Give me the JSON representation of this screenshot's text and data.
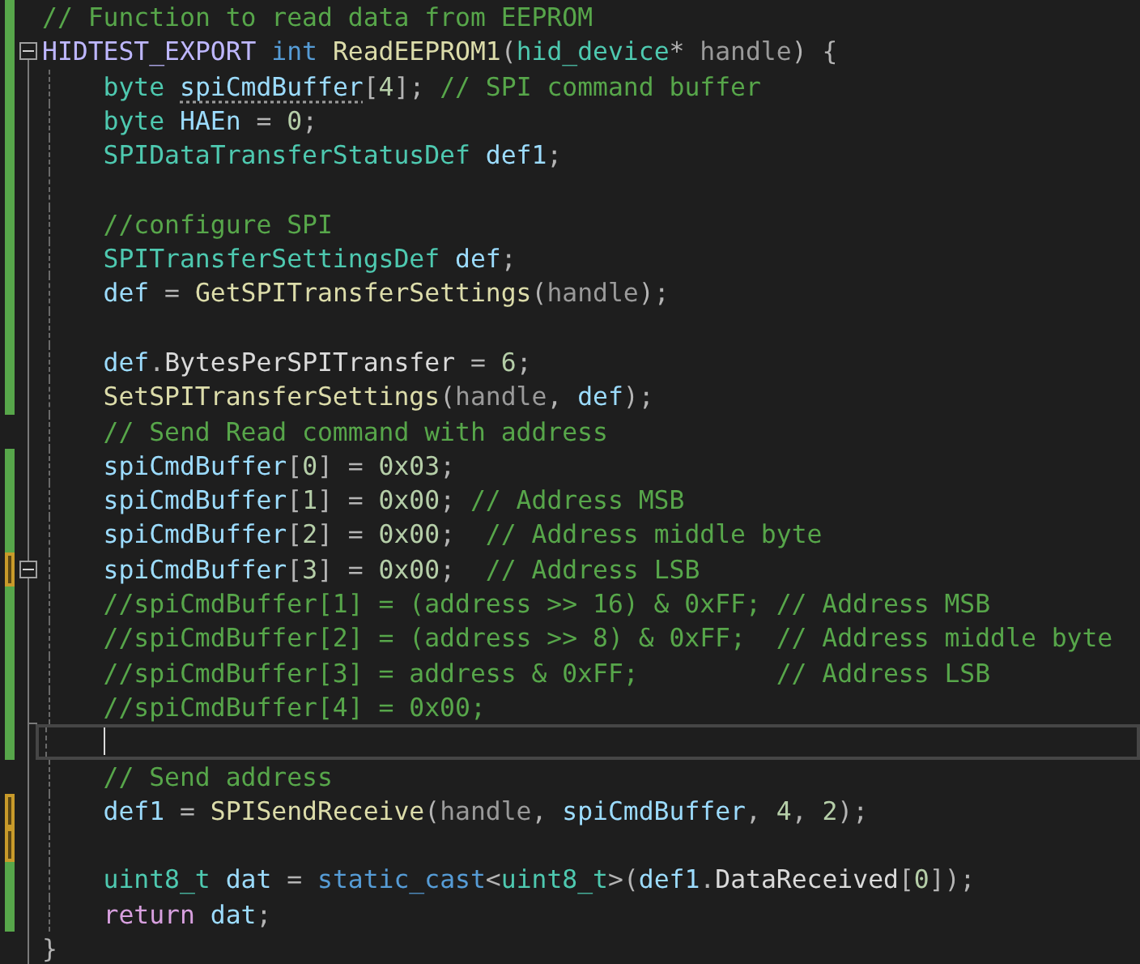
{
  "editor": {
    "lines": [
      {
        "modified": true,
        "saved": true,
        "in_fold": false,
        "collapsible": false,
        "fold_end": false,
        "guide": false,
        "tokens": [
          {
            "kind": "comment",
            "text": "// Function to read data from EEPROM"
          }
        ]
      },
      {
        "modified": true,
        "saved": true,
        "in_fold": true,
        "collapsible": true,
        "fold_end": false,
        "guide": false,
        "tokens": [
          {
            "kind": "macro",
            "text": "HIDTEST_EXPORT "
          },
          {
            "kind": "keyword",
            "text": "int "
          },
          {
            "kind": "function",
            "text": "ReadEEPROM1"
          },
          {
            "kind": "punct",
            "text": "("
          },
          {
            "kind": "type",
            "text": "hid_device"
          },
          {
            "kind": "punct",
            "text": "* "
          },
          {
            "kind": "param",
            "text": "handle"
          },
          {
            "kind": "punct",
            "text": ") {"
          }
        ]
      },
      {
        "modified": true,
        "saved": true,
        "in_fold": true,
        "collapsible": false,
        "fold_end": false,
        "guide": true,
        "tokens": [
          {
            "kind": "type",
            "text": "byte "
          },
          {
            "kind": "variable",
            "text": "spiCmdBuffer",
            "suggestion": true
          },
          {
            "kind": "punct",
            "text": "["
          },
          {
            "kind": "number",
            "text": "4"
          },
          {
            "kind": "punct",
            "text": "]; "
          },
          {
            "kind": "comment",
            "text": "// SPI command buffer"
          }
        ]
      },
      {
        "modified": true,
        "saved": true,
        "in_fold": true,
        "collapsible": false,
        "fold_end": false,
        "guide": true,
        "tokens": [
          {
            "kind": "type",
            "text": "byte "
          },
          {
            "kind": "variable",
            "text": "HAEn"
          },
          {
            "kind": "punct",
            "text": " = "
          },
          {
            "kind": "number",
            "text": "0"
          },
          {
            "kind": "punct",
            "text": ";"
          }
        ]
      },
      {
        "modified": true,
        "saved": true,
        "in_fold": true,
        "collapsible": false,
        "fold_end": false,
        "guide": true,
        "tokens": [
          {
            "kind": "type",
            "text": "SPIDataTransferStatusDef "
          },
          {
            "kind": "variable",
            "text": "def1"
          },
          {
            "kind": "punct",
            "text": ";"
          }
        ]
      },
      {
        "modified": true,
        "saved": true,
        "in_fold": true,
        "collapsible": false,
        "fold_end": false,
        "guide": true
      },
      {
        "modified": true,
        "saved": true,
        "in_fold": true,
        "collapsible": false,
        "fold_end": false,
        "guide": true,
        "tokens": [
          {
            "kind": "comment",
            "text": "//configure SPI"
          }
        ]
      },
      {
        "modified": true,
        "saved": true,
        "in_fold": true,
        "collapsible": false,
        "fold_end": false,
        "guide": true,
        "tokens": [
          {
            "kind": "type",
            "text": "SPITransferSettingsDef "
          },
          {
            "kind": "variable",
            "text": "def"
          },
          {
            "kind": "punct",
            "text": ";"
          }
        ]
      },
      {
        "modified": true,
        "saved": true,
        "in_fold": true,
        "collapsible": false,
        "fold_end": false,
        "guide": true,
        "tokens": [
          {
            "kind": "variable",
            "text": "def"
          },
          {
            "kind": "punct",
            "text": " = "
          },
          {
            "kind": "function",
            "text": "GetSPITransferSettings"
          },
          {
            "kind": "punct",
            "text": "("
          },
          {
            "kind": "param",
            "text": "handle"
          },
          {
            "kind": "punct",
            "text": ");"
          }
        ]
      },
      {
        "modified": true,
        "saved": true,
        "in_fold": true,
        "collapsible": false,
        "fold_end": false,
        "guide": true
      },
      {
        "modified": true,
        "saved": true,
        "in_fold": true,
        "collapsible": false,
        "fold_end": false,
        "guide": true,
        "tokens": [
          {
            "kind": "variable",
            "text": "def"
          },
          {
            "kind": "punct",
            "text": "."
          },
          {
            "kind": "member",
            "text": "BytesPerSPITransfer"
          },
          {
            "kind": "punct",
            "text": " = "
          },
          {
            "kind": "number",
            "text": "6"
          },
          {
            "kind": "punct",
            "text": ";"
          }
        ]
      },
      {
        "modified": true,
        "saved": true,
        "in_fold": true,
        "collapsible": false,
        "fold_end": false,
        "guide": true,
        "tokens": [
          {
            "kind": "function",
            "text": "SetSPITransferSettings"
          },
          {
            "kind": "punct",
            "text": "("
          },
          {
            "kind": "param",
            "text": "handle"
          },
          {
            "kind": "punct",
            "text": ", "
          },
          {
            "kind": "variable",
            "text": "def"
          },
          {
            "kind": "punct",
            "text": ");"
          }
        ]
      },
      {
        "modified": false,
        "in_fold": true,
        "collapsible": false,
        "fold_end": false,
        "guide": true,
        "tokens": [
          {
            "kind": "comment",
            "text": "// Send Read command with address"
          }
        ]
      },
      {
        "modified": true,
        "saved": true,
        "in_fold": true,
        "collapsible": false,
        "fold_end": false,
        "guide": true,
        "tokens": [
          {
            "kind": "variable",
            "text": "spiCmdBuffer"
          },
          {
            "kind": "punct",
            "text": "["
          },
          {
            "kind": "number",
            "text": "0"
          },
          {
            "kind": "punct",
            "text": "] = "
          },
          {
            "kind": "number",
            "text": "0x03"
          },
          {
            "kind": "punct",
            "text": ";"
          }
        ]
      },
      {
        "modified": true,
        "saved": true,
        "in_fold": true,
        "collapsible": false,
        "fold_end": false,
        "guide": true,
        "tokens": [
          {
            "kind": "variable",
            "text": "spiCmdBuffer"
          },
          {
            "kind": "punct",
            "text": "["
          },
          {
            "kind": "number",
            "text": "1"
          },
          {
            "kind": "punct",
            "text": "] = "
          },
          {
            "kind": "number",
            "text": "0x00"
          },
          {
            "kind": "punct",
            "text": "; "
          },
          {
            "kind": "comment",
            "text": "// Address MSB"
          }
        ]
      },
      {
        "modified": true,
        "saved": true,
        "in_fold": true,
        "collapsible": false,
        "fold_end": false,
        "guide": true,
        "tokens": [
          {
            "kind": "variable",
            "text": "spiCmdBuffer"
          },
          {
            "kind": "punct",
            "text": "["
          },
          {
            "kind": "number",
            "text": "2"
          },
          {
            "kind": "punct",
            "text": "] = "
          },
          {
            "kind": "number",
            "text": "0x00"
          },
          {
            "kind": "punct",
            "text": ";  "
          },
          {
            "kind": "comment",
            "text": "// Address middle byte"
          }
        ]
      },
      {
        "modified": true,
        "saved": false,
        "in_fold": true,
        "collapsible": true,
        "fold_end": false,
        "guide": true,
        "tokens": [
          {
            "kind": "variable",
            "text": "spiCmdBuffer"
          },
          {
            "kind": "punct",
            "text": "["
          },
          {
            "kind": "number",
            "text": "3"
          },
          {
            "kind": "punct",
            "text": "] = "
          },
          {
            "kind": "number",
            "text": "0x00"
          },
          {
            "kind": "punct",
            "text": ";  "
          },
          {
            "kind": "comment",
            "text": "// Address LSB"
          }
        ]
      },
      {
        "modified": true,
        "saved": true,
        "in_fold": true,
        "collapsible": false,
        "fold_end": false,
        "guide": true,
        "tokens": [
          {
            "kind": "comment",
            "text": "//spiCmdBuffer[1] = (address >> 16) & 0xFF; // Address MSB"
          }
        ]
      },
      {
        "modified": true,
        "saved": true,
        "in_fold": true,
        "collapsible": false,
        "fold_end": false,
        "guide": true,
        "tokens": [
          {
            "kind": "comment",
            "text": "//spiCmdBuffer[2] = (address >> 8) & 0xFF;  // Address middle byte"
          }
        ]
      },
      {
        "modified": true,
        "saved": true,
        "in_fold": true,
        "collapsible": false,
        "fold_end": false,
        "guide": true,
        "tokens": [
          {
            "kind": "comment",
            "text": "//spiCmdBuffer[3] = address & 0xFF;         // Address LSB"
          }
        ]
      },
      {
        "modified": true,
        "saved": true,
        "in_fold": true,
        "collapsible": false,
        "fold_end": true,
        "guide": true,
        "tokens": [
          {
            "kind": "comment",
            "text": "//spiCmdBuffer[4] = 0x00;"
          }
        ]
      },
      {
        "modified": true,
        "saved": true,
        "in_fold": true,
        "collapsible": false,
        "fold_end": false,
        "guide": true,
        "current": true
      },
      {
        "modified": false,
        "in_fold": true,
        "collapsible": false,
        "fold_end": false,
        "guide": true,
        "tokens": [
          {
            "kind": "comment",
            "text": "// Send address"
          }
        ]
      },
      {
        "modified": true,
        "saved": false,
        "in_fold": true,
        "collapsible": false,
        "fold_end": false,
        "guide": true,
        "tokens": [
          {
            "kind": "variable",
            "text": "def1"
          },
          {
            "kind": "punct",
            "text": " = "
          },
          {
            "kind": "function",
            "text": "SPISendReceive"
          },
          {
            "kind": "punct",
            "text": "("
          },
          {
            "kind": "param",
            "text": "handle"
          },
          {
            "kind": "punct",
            "text": ", "
          },
          {
            "kind": "variable",
            "text": "spiCmdBuffer"
          },
          {
            "kind": "punct",
            "text": ", "
          },
          {
            "kind": "number",
            "text": "4"
          },
          {
            "kind": "punct",
            "text": ", "
          },
          {
            "kind": "number",
            "text": "2"
          },
          {
            "kind": "punct",
            "text": ");"
          }
        ]
      },
      {
        "modified": true,
        "saved": false,
        "in_fold": true,
        "collapsible": false,
        "fold_end": false,
        "guide": true
      },
      {
        "modified": true,
        "saved": true,
        "in_fold": true,
        "collapsible": false,
        "fold_end": false,
        "guide": true,
        "tokens": [
          {
            "kind": "type",
            "text": "uint8_t "
          },
          {
            "kind": "variable",
            "text": "dat"
          },
          {
            "kind": "punct",
            "text": " = "
          },
          {
            "kind": "keyword",
            "text": "static_cast"
          },
          {
            "kind": "punct",
            "text": "<"
          },
          {
            "kind": "type",
            "text": "uint8_t"
          },
          {
            "kind": "punct",
            "text": ">("
          },
          {
            "kind": "variable",
            "text": "def1"
          },
          {
            "kind": "punct",
            "text": "."
          },
          {
            "kind": "member",
            "text": "DataReceived"
          },
          {
            "kind": "punct",
            "text": "["
          },
          {
            "kind": "number",
            "text": "0"
          },
          {
            "kind": "punct",
            "text": "]);"
          }
        ]
      },
      {
        "modified": true,
        "saved": true,
        "in_fold": true,
        "collapsible": false,
        "fold_end": false,
        "guide": true,
        "tokens": [
          {
            "kind": "control",
            "text": "return "
          },
          {
            "kind": "variable",
            "text": "dat"
          },
          {
            "kind": "punct",
            "text": ";"
          }
        ]
      },
      {
        "modified": false,
        "in_fold": true,
        "collapsible": false,
        "fold_end": true,
        "guide": false,
        "tokens": [
          {
            "kind": "punct",
            "text": "}"
          }
        ]
      }
    ]
  }
}
